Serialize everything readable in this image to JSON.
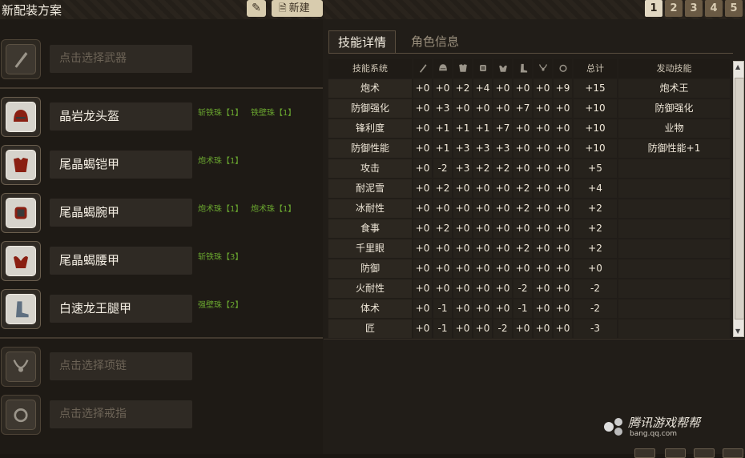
{
  "app": {
    "title": "新配装方案",
    "new_label": "新建",
    "pages": [
      "1",
      "2",
      "3",
      "4",
      "5"
    ],
    "active_page": "1"
  },
  "slots": [
    {
      "name": "点击选择武器",
      "empty": true,
      "icon": "weapon-icon",
      "decorations": []
    },
    {
      "name": "晶岩龙头盔",
      "empty": false,
      "icon": "helmet-icon",
      "decorations": [
        "斩铁珠【1】",
        "铁壁珠【1】"
      ]
    },
    {
      "name": "尾晶蝎铠甲",
      "empty": false,
      "icon": "chest-armor-icon",
      "decorations": [
        "炮术珠【1】"
      ]
    },
    {
      "name": "尾晶蝎腕甲",
      "empty": false,
      "icon": "arm-armor-icon",
      "decorations": [
        "炮术珠【1】",
        "炮术珠【1】"
      ]
    },
    {
      "name": "尾晶蝎腰甲",
      "empty": false,
      "icon": "waist-armor-icon",
      "decorations": [
        "斩铁珠【3】"
      ]
    },
    {
      "name": "白速龙王腿甲",
      "empty": false,
      "icon": "leg-armor-icon",
      "decorations": [
        "强壁珠【2】"
      ]
    },
    {
      "name": "点击选择项链",
      "empty": true,
      "icon": "necklace-icon",
      "decorations": []
    },
    {
      "name": "点击选择戒指",
      "empty": true,
      "icon": "ring-icon",
      "decorations": []
    }
  ],
  "tabs": [
    "技能详情",
    "角色信息"
  ],
  "skill_table": {
    "header": {
      "skill_system": "技能系统",
      "piece_icons": [
        "weapon-icon",
        "helmet-icon",
        "chest-armor-icon",
        "arm-armor-icon",
        "waist-armor-icon",
        "leg-armor-icon",
        "necklace-icon",
        "ring-icon"
      ],
      "total": "总计",
      "activated": "发动技能"
    },
    "rows": [
      {
        "name": "炮术",
        "v": [
          "+0",
          "+0",
          "+2",
          "+4",
          "+0",
          "+0",
          "+0",
          "+9"
        ],
        "total": "+15",
        "skill": "炮术王"
      },
      {
        "name": "防御强化",
        "v": [
          "+0",
          "+3",
          "+0",
          "+0",
          "+0",
          "+7",
          "+0",
          "+0"
        ],
        "total": "+10",
        "skill": "防御强化"
      },
      {
        "name": "锋利度",
        "v": [
          "+0",
          "+1",
          "+1",
          "+1",
          "+7",
          "+0",
          "+0",
          "+0"
        ],
        "total": "+10",
        "skill": "业物"
      },
      {
        "name": "防御性能",
        "v": [
          "+0",
          "+1",
          "+3",
          "+3",
          "+3",
          "+0",
          "+0",
          "+0"
        ],
        "total": "+10",
        "skill": "防御性能+1"
      },
      {
        "name": "攻击",
        "v": [
          "+0",
          "-2",
          "+3",
          "+2",
          "+2",
          "+0",
          "+0",
          "+0"
        ],
        "total": "+5",
        "skill": ""
      },
      {
        "name": "耐泥雪",
        "v": [
          "+0",
          "+2",
          "+0",
          "+0",
          "+0",
          "+2",
          "+0",
          "+0"
        ],
        "total": "+4",
        "skill": ""
      },
      {
        "name": "冰耐性",
        "v": [
          "+0",
          "+0",
          "+0",
          "+0",
          "+0",
          "+2",
          "+0",
          "+0"
        ],
        "total": "+2",
        "skill": ""
      },
      {
        "name": "食事",
        "v": [
          "+0",
          "+2",
          "+0",
          "+0",
          "+0",
          "+0",
          "+0",
          "+0"
        ],
        "total": "+2",
        "skill": ""
      },
      {
        "name": "千里眼",
        "v": [
          "+0",
          "+0",
          "+0",
          "+0",
          "+0",
          "+2",
          "+0",
          "+0"
        ],
        "total": "+2",
        "skill": ""
      },
      {
        "name": "防御",
        "v": [
          "+0",
          "+0",
          "+0",
          "+0",
          "+0",
          "+0",
          "+0",
          "+0"
        ],
        "total": "+0",
        "skill": ""
      },
      {
        "name": "火耐性",
        "v": [
          "+0",
          "+0",
          "+0",
          "+0",
          "+0",
          "-2",
          "+0",
          "+0"
        ],
        "total": "-2",
        "skill": ""
      },
      {
        "name": "体术",
        "v": [
          "+0",
          "-1",
          "+0",
          "+0",
          "+0",
          "-1",
          "+0",
          "+0"
        ],
        "total": "-2",
        "skill": ""
      },
      {
        "name": "匠",
        "v": [
          "+0",
          "-1",
          "+0",
          "+0",
          "-2",
          "+0",
          "+0",
          "+0"
        ],
        "total": "-3",
        "skill": ""
      }
    ]
  },
  "watermark": {
    "main": "腾讯游戏帮帮",
    "url": "bang.qq.com"
  }
}
